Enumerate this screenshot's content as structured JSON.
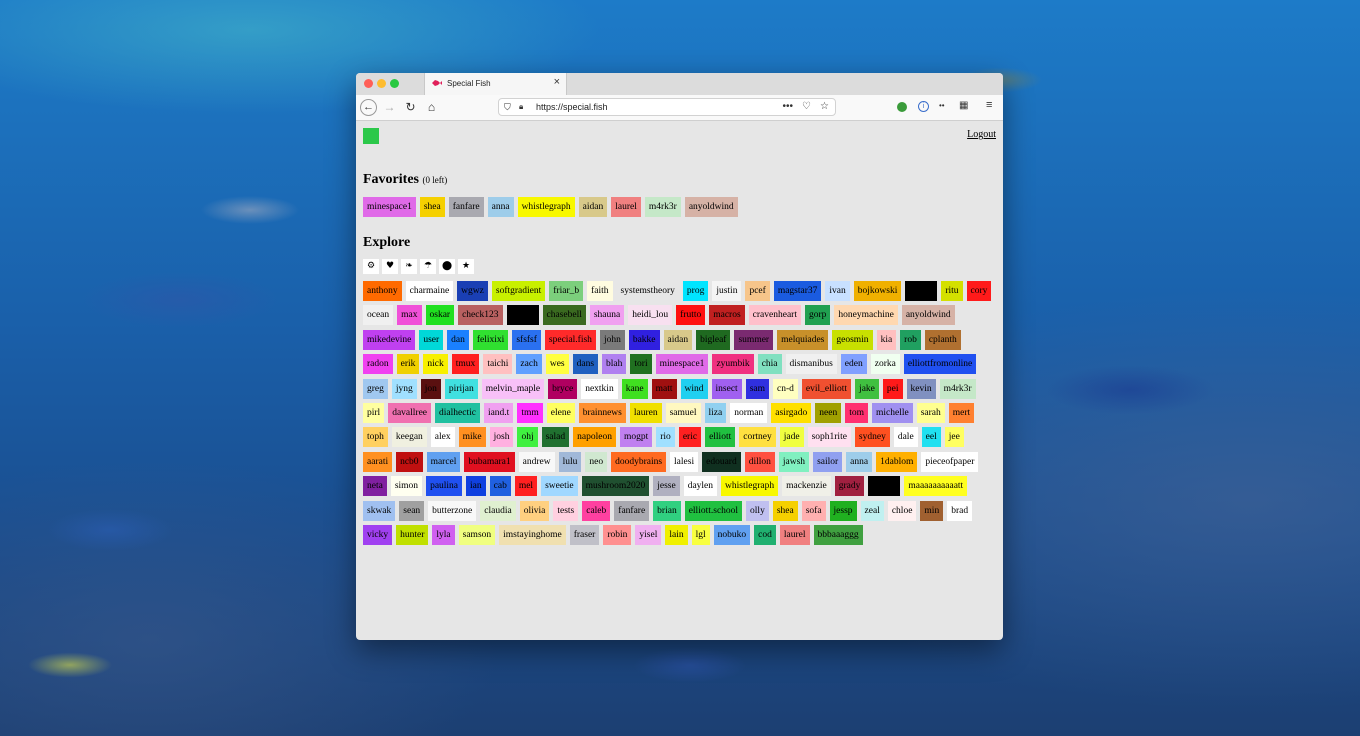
{
  "browser": {
    "tab_title": "Special Fish",
    "url": "https://special.fish",
    "icons": [
      "back-icon",
      "forward-icon",
      "reload-icon",
      "home-icon",
      "shield-icon",
      "lock-icon",
      "more-icon",
      "pocket-icon",
      "bookmark-star-icon",
      "extension-green-icon",
      "extension-info-icon",
      "extension-key-icon",
      "extension-grid-icon",
      "menu-icon"
    ]
  },
  "page": {
    "logout_label": "Logout",
    "favorites_heading": "Favorites",
    "favorites_note": "(0 left)",
    "explore_heading": "Explore"
  },
  "filters": [
    "⚙",
    "♥",
    "❧",
    "☂",
    "⬤",
    "★"
  ],
  "favorites": [
    {
      "name": "minespace1",
      "bg": "#e06ae8",
      "fg": "#000"
    },
    {
      "name": "shea",
      "bg": "#f5d000",
      "fg": "#000"
    },
    {
      "name": "fanfare",
      "bg": "#a9a9b0",
      "fg": "#000"
    },
    {
      "name": "anna",
      "bg": "#9ecdea",
      "fg": "#000"
    },
    {
      "name": "whistlegraph",
      "bg": "#f8f800",
      "fg": "#000"
    },
    {
      "name": "aidan",
      "bg": "#d8c98a",
      "fg": "#000"
    },
    {
      "name": "laurel",
      "bg": "#f08080",
      "fg": "#000"
    },
    {
      "name": "m4rk3r",
      "bg": "#c5e8c8",
      "fg": "#000"
    },
    {
      "name": "anyoldwind",
      "bg": "#d6b2a6",
      "fg": "#000"
    }
  ],
  "explore": [
    {
      "name": "anthony",
      "bg": "#ff6a00",
      "fg": "#000"
    },
    {
      "name": "charmaine",
      "bg": "#ffffff",
      "fg": "#000"
    },
    {
      "name": "wgwz",
      "bg": "#1a3fb4",
      "fg": "#000"
    },
    {
      "name": "softgradient",
      "bg": "#c8f000",
      "fg": "#000"
    },
    {
      "name": "friar_b",
      "bg": "#7ccf7c",
      "fg": "#000"
    },
    {
      "name": "faith",
      "bg": "#fffce0",
      "fg": "#000"
    },
    {
      "name": "systemstheory",
      "bg": "#e6e6e6",
      "fg": "#000"
    },
    {
      "name": "prog",
      "bg": "#00e5ff",
      "fg": "#000"
    },
    {
      "name": "justin",
      "bg": "#f4f4f4",
      "fg": "#000"
    },
    {
      "name": "pcef",
      "bg": "#f7c58a",
      "fg": "#000"
    },
    {
      "name": "magstar37",
      "bg": "#1a5be0",
      "fg": "#000"
    },
    {
      "name": "ivan",
      "bg": "#c8e0ff",
      "fg": "#000"
    },
    {
      "name": "bojkowski",
      "bg": "#f0b000",
      "fg": "#000"
    },
    {
      "name": "",
      "bg": "#000000",
      "fg": "#000"
    },
    {
      "name": "ritu",
      "bg": "#d4e000",
      "fg": "#000"
    },
    {
      "name": "cory",
      "bg": "#ff1a1a",
      "fg": "#000"
    },
    {
      "name": "ocean",
      "bg": "#f0f0f0",
      "fg": "#000"
    },
    {
      "name": "max",
      "bg": "#f050d8",
      "fg": "#000"
    },
    {
      "name": "oskar",
      "bg": "#20e020",
      "fg": "#000"
    },
    {
      "name": "check123",
      "bg": "#b86060",
      "fg": "#000"
    },
    {
      "name": "",
      "bg": "#000000",
      "fg": "#000"
    },
    {
      "name": "chasebell",
      "bg": "#3a6a20",
      "fg": "#000"
    },
    {
      "name": "shauna",
      "bg": "#f0a0f0",
      "fg": "#000"
    },
    {
      "name": "heidi_lou",
      "bg": "#f8e0f0",
      "fg": "#000"
    },
    {
      "name": "frutto",
      "bg": "#ff1010",
      "fg": "#000"
    },
    {
      "name": "macros",
      "bg": "#c02020",
      "fg": "#000"
    },
    {
      "name": "cravenheart",
      "bg": "#ffc0cb",
      "fg": "#000"
    },
    {
      "name": "gorp",
      "bg": "#20a050",
      "fg": "#000"
    },
    {
      "name": "honeymachine",
      "bg": "#ffd8b0",
      "fg": "#000"
    },
    {
      "name": "anyoldwind",
      "bg": "#d6b2a6",
      "fg": "#000"
    },
    {
      "name": "mikedevine",
      "bg": "#c040f0",
      "fg": "#000"
    },
    {
      "name": "user",
      "bg": "#00d8d8",
      "fg": "#000"
    },
    {
      "name": "dan",
      "bg": "#1a80ff",
      "fg": "#000"
    },
    {
      "name": "felixixi",
      "bg": "#30e030",
      "fg": "#000"
    },
    {
      "name": "sfsfsf",
      "bg": "#2a70f0",
      "fg": "#000"
    },
    {
      "name": "special.fish",
      "bg": "#ff2a2a",
      "fg": "#000"
    },
    {
      "name": "john",
      "bg": "#7a7a7a",
      "fg": "#000"
    },
    {
      "name": "bakke",
      "bg": "#3020e0",
      "fg": "#000"
    },
    {
      "name": "aidan",
      "bg": "#d8c98a",
      "fg": "#000"
    },
    {
      "name": "bigleaf",
      "bg": "#1f6a20",
      "fg": "#000"
    },
    {
      "name": "summer",
      "bg": "#7a2a70",
      "fg": "#000"
    },
    {
      "name": "melquiades",
      "bg": "#c8902a",
      "fg": "#000"
    },
    {
      "name": "geosmin",
      "bg": "#c8e000",
      "fg": "#000"
    },
    {
      "name": "kia",
      "bg": "#ffc0c0",
      "fg": "#000"
    },
    {
      "name": "rob",
      "bg": "#20a060",
      "fg": "#000"
    },
    {
      "name": "cplanth",
      "bg": "#b07030",
      "fg": "#000"
    },
    {
      "name": "radon",
      "bg": "#f040f0",
      "fg": "#000"
    },
    {
      "name": "erik",
      "bg": "#f0d000",
      "fg": "#000"
    },
    {
      "name": "nick",
      "bg": "#f8f000",
      "fg": "#000"
    },
    {
      "name": "tmux",
      "bg": "#ff2020",
      "fg": "#000"
    },
    {
      "name": "taichi",
      "bg": "#ffc0c0",
      "fg": "#000"
    },
    {
      "name": "zach",
      "bg": "#60a0ff",
      "fg": "#000"
    },
    {
      "name": "wes",
      "bg": "#ffff40",
      "fg": "#000"
    },
    {
      "name": "dans",
      "bg": "#2060c0",
      "fg": "#000"
    },
    {
      "name": "blah",
      "bg": "#b080f0",
      "fg": "#000"
    },
    {
      "name": "tori",
      "bg": "#207020",
      "fg": "#000"
    },
    {
      "name": "minespace1",
      "bg": "#e06ae8",
      "fg": "#000"
    },
    {
      "name": "zyumbik",
      "bg": "#f03080",
      "fg": "#000"
    },
    {
      "name": "chia",
      "bg": "#80e0c0",
      "fg": "#000"
    },
    {
      "name": "dismanibus",
      "bg": "#f0f0f0",
      "fg": "#000"
    },
    {
      "name": "eden",
      "bg": "#80a0ff",
      "fg": "#000"
    },
    {
      "name": "zorka",
      "bg": "#f0fff0",
      "fg": "#000"
    },
    {
      "name": "elliottfromonline",
      "bg": "#2050f0",
      "fg": "#000"
    },
    {
      "name": "greg",
      "bg": "#a0c8f0",
      "fg": "#000"
    },
    {
      "name": "jyng",
      "bg": "#a0e0ff",
      "fg": "#000"
    },
    {
      "name": "jon",
      "bg": "#5a1010",
      "fg": "#000"
    },
    {
      "name": "pirijan",
      "bg": "#40e0e0",
      "fg": "#000"
    },
    {
      "name": "melvin_maple",
      "bg": "#f8c0f8",
      "fg": "#000"
    },
    {
      "name": "bryce",
      "bg": "#b00060",
      "fg": "#000"
    },
    {
      "name": "nextkin",
      "bg": "#ffffff",
      "fg": "#000"
    },
    {
      "name": "kane",
      "bg": "#40e020",
      "fg": "#000"
    },
    {
      "name": "matt",
      "bg": "#a01010",
      "fg": "#000"
    },
    {
      "name": "wind",
      "bg": "#20d0f0",
      "fg": "#000"
    },
    {
      "name": "insect",
      "bg": "#a060f0",
      "fg": "#000"
    },
    {
      "name": "sam",
      "bg": "#3030e0",
      "fg": "#000"
    },
    {
      "name": "cn-d",
      "bg": "#ffffc0",
      "fg": "#000"
    },
    {
      "name": "evil_elliott",
      "bg": "#f05030",
      "fg": "#000"
    },
    {
      "name": "jake",
      "bg": "#40c040",
      "fg": "#000"
    },
    {
      "name": "pei",
      "bg": "#ff1a1a",
      "fg": "#000"
    },
    {
      "name": "kevin",
      "bg": "#8090c0",
      "fg": "#000"
    },
    {
      "name": "m4rk3r",
      "bg": "#c5e8c8",
      "fg": "#000"
    },
    {
      "name": "pirl",
      "bg": "#ffffa0",
      "fg": "#000"
    },
    {
      "name": "davallree",
      "bg": "#f070b0",
      "fg": "#000"
    },
    {
      "name": "dialhectic",
      "bg": "#20c0a0",
      "fg": "#000"
    },
    {
      "name": "iand.t",
      "bg": "#f0a0f0",
      "fg": "#000"
    },
    {
      "name": "tmm",
      "bg": "#ff30ff",
      "fg": "#000"
    },
    {
      "name": "elene",
      "bg": "#ffff60",
      "fg": "#000"
    },
    {
      "name": "brainnews",
      "bg": "#ff9030",
      "fg": "#000"
    },
    {
      "name": "lauren",
      "bg": "#f0e000",
      "fg": "#000"
    },
    {
      "name": "samuel",
      "bg": "#fff8c0",
      "fg": "#000"
    },
    {
      "name": "liza",
      "bg": "#90d0f0",
      "fg": "#000"
    },
    {
      "name": "norman",
      "bg": "#ffffff",
      "fg": "#000"
    },
    {
      "name": "asirgado",
      "bg": "#ffe000",
      "fg": "#000"
    },
    {
      "name": "neen",
      "bg": "#a0a000",
      "fg": "#000"
    },
    {
      "name": "tom",
      "bg": "#ff3070",
      "fg": "#000"
    },
    {
      "name": "michelle",
      "bg": "#a090f0",
      "fg": "#000"
    },
    {
      "name": "sarah",
      "bg": "#ffff90",
      "fg": "#000"
    },
    {
      "name": "mert",
      "bg": "#ff8030",
      "fg": "#000"
    },
    {
      "name": "toph",
      "bg": "#ffd060",
      "fg": "#000"
    },
    {
      "name": "keegan",
      "bg": "#f0f0e0",
      "fg": "#000"
    },
    {
      "name": "alex",
      "bg": "#ffffff",
      "fg": "#000"
    },
    {
      "name": "mike",
      "bg": "#ff9020",
      "fg": "#000"
    },
    {
      "name": "josh",
      "bg": "#ffb0e0",
      "fg": "#000"
    },
    {
      "name": "ohj",
      "bg": "#40f040",
      "fg": "#000"
    },
    {
      "name": "salad",
      "bg": "#207030",
      "fg": "#000"
    },
    {
      "name": "napoleon",
      "bg": "#ffa000",
      "fg": "#000"
    },
    {
      "name": "mogpt",
      "bg": "#c080f0",
      "fg": "#000"
    },
    {
      "name": "rio",
      "bg": "#a0e0ff",
      "fg": "#000"
    },
    {
      "name": "eric",
      "bg": "#ff2020",
      "fg": "#000"
    },
    {
      "name": "elliott",
      "bg": "#20c040",
      "fg": "#000"
    },
    {
      "name": "cortney",
      "bg": "#ffe040",
      "fg": "#000"
    },
    {
      "name": "jade",
      "bg": "#f0ff40",
      "fg": "#000"
    },
    {
      "name": "soph1rite",
      "bg": "#ffe0f0",
      "fg": "#000"
    },
    {
      "name": "sydney",
      "bg": "#ff5020",
      "fg": "#000"
    },
    {
      "name": "dale",
      "bg": "#ffffff",
      "fg": "#000"
    },
    {
      "name": "eel",
      "bg": "#20e0f0",
      "fg": "#000"
    },
    {
      "name": "jee",
      "bg": "#ffff60",
      "fg": "#000"
    },
    {
      "name": "aarati",
      "bg": "#ff9020",
      "fg": "#000"
    },
    {
      "name": "ncb0",
      "bg": "#c01010",
      "fg": "#000"
    },
    {
      "name": "marcel",
      "bg": "#60a0f0",
      "fg": "#000"
    },
    {
      "name": "bubamara1",
      "bg": "#e01020",
      "fg": "#000"
    },
    {
      "name": "andrew",
      "bg": "#f8f8f8",
      "fg": "#000"
    },
    {
      "name": "lulu",
      "bg": "#a0b8d8",
      "fg": "#000"
    },
    {
      "name": "neo",
      "bg": "#d0e8d0",
      "fg": "#000"
    },
    {
      "name": "doodybrains",
      "bg": "#ff6a20",
      "fg": "#000"
    },
    {
      "name": "lalesi",
      "bg": "#ffffff",
      "fg": "#000"
    },
    {
      "name": "edouard",
      "bg": "#103020",
      "fg": "#000"
    },
    {
      "name": "dillon",
      "bg": "#ff5040",
      "fg": "#000"
    },
    {
      "name": "jawsh",
      "bg": "#80f0c0",
      "fg": "#000"
    },
    {
      "name": "sailor",
      "bg": "#90a0f0",
      "fg": "#000"
    },
    {
      "name": "anna",
      "bg": "#9ecdea",
      "fg": "#000"
    },
    {
      "name": "1dablom",
      "bg": "#ffb000",
      "fg": "#000"
    },
    {
      "name": "pieceofpaper",
      "bg": "#ffffff",
      "fg": "#000"
    },
    {
      "name": "neta",
      "bg": "#8020a0",
      "fg": "#000"
    },
    {
      "name": "simon",
      "bg": "#fffff0",
      "fg": "#000"
    },
    {
      "name": "paulina",
      "bg": "#2050f0",
      "fg": "#000"
    },
    {
      "name": "ian",
      "bg": "#1040e0",
      "fg": "#000"
    },
    {
      "name": "cab",
      "bg": "#2060e0",
      "fg": "#000"
    },
    {
      "name": "mel",
      "bg": "#ff2020",
      "fg": "#000"
    },
    {
      "name": "sweetie",
      "bg": "#a0d8ff",
      "fg": "#000"
    },
    {
      "name": "mushroom2020",
      "bg": "#205030",
      "fg": "#000"
    },
    {
      "name": "jesse",
      "bg": "#b0b0c0",
      "fg": "#000"
    },
    {
      "name": "daylen",
      "bg": "#ffffff",
      "fg": "#000"
    },
    {
      "name": "whistlegraph",
      "bg": "#f8f800",
      "fg": "#000"
    },
    {
      "name": "mackenzie",
      "bg": "#f0f0e8",
      "fg": "#000"
    },
    {
      "name": "grady",
      "bg": "#a02040",
      "fg": "#000"
    },
    {
      "name": "",
      "bg": "#000000",
      "fg": "#000"
    },
    {
      "name": "maaaaaaaaaatt",
      "bg": "#ffff20",
      "fg": "#000"
    },
    {
      "name": "skwak",
      "bg": "#a0c0f0",
      "fg": "#000"
    },
    {
      "name": "sean",
      "bg": "#a0a0a0",
      "fg": "#000"
    },
    {
      "name": "butterzone",
      "bg": "#f8f8f8",
      "fg": "#000"
    },
    {
      "name": "claudia",
      "bg": "#e0f0d0",
      "fg": "#000"
    },
    {
      "name": "olivia",
      "bg": "#ffd080",
      "fg": "#000"
    },
    {
      "name": "tests",
      "bg": "#ffd0e0",
      "fg": "#000"
    },
    {
      "name": "caleb",
      "bg": "#ff40a0",
      "fg": "#000"
    },
    {
      "name": "fanfare",
      "bg": "#a9a9b0",
      "fg": "#000"
    },
    {
      "name": "brian",
      "bg": "#30d080",
      "fg": "#000"
    },
    {
      "name": "elliott.school",
      "bg": "#20c040",
      "fg": "#000"
    },
    {
      "name": "olly",
      "bg": "#c0c0f0",
      "fg": "#000"
    },
    {
      "name": "shea",
      "bg": "#f5d000",
      "fg": "#000"
    },
    {
      "name": "sofa",
      "bg": "#ffb0b0",
      "fg": "#000"
    },
    {
      "name": "jessp",
      "bg": "#20b020",
      "fg": "#000"
    },
    {
      "name": "zeal",
      "bg": "#c0f0f0",
      "fg": "#000"
    },
    {
      "name": "chloe",
      "bg": "#fff0f0",
      "fg": "#000"
    },
    {
      "name": "min",
      "bg": "#a06030",
      "fg": "#000"
    },
    {
      "name": "brad",
      "bg": "#ffffff",
      "fg": "#000"
    },
    {
      "name": "vicky",
      "bg": "#a040f0",
      "fg": "#000"
    },
    {
      "name": "hunter",
      "bg": "#c0e000",
      "fg": "#000"
    },
    {
      "name": "lyla",
      "bg": "#d060f0",
      "fg": "#000"
    },
    {
      "name": "samson",
      "bg": "#f0ff80",
      "fg": "#000"
    },
    {
      "name": "imstayinghome",
      "bg": "#f0e0b0",
      "fg": "#000"
    },
    {
      "name": "fraser",
      "bg": "#c0c0c8",
      "fg": "#000"
    },
    {
      "name": "robin",
      "bg": "#ff9090",
      "fg": "#000"
    },
    {
      "name": "yisel",
      "bg": "#f0b0f0",
      "fg": "#000"
    },
    {
      "name": "lain",
      "bg": "#f0f000",
      "fg": "#000"
    },
    {
      "name": "lgl",
      "bg": "#f8ff40",
      "fg": "#000"
    },
    {
      "name": "nobuko",
      "bg": "#60a0f0",
      "fg": "#000"
    },
    {
      "name": "cod",
      "bg": "#20b070",
      "fg": "#000"
    },
    {
      "name": "laurel",
      "bg": "#f08080",
      "fg": "#000"
    },
    {
      "name": "bbbaaaggg",
      "bg": "#40a040",
      "fg": "#000"
    }
  ]
}
